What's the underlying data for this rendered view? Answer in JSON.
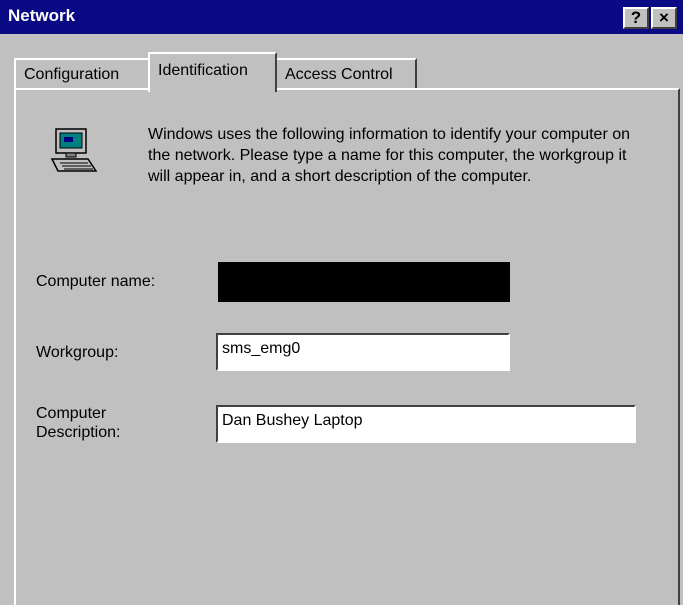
{
  "window": {
    "title": "Network",
    "help_label": "?",
    "close_label": "×"
  },
  "tabs": [
    {
      "label": "Configuration",
      "selected": false
    },
    {
      "label": "Identification",
      "selected": true
    },
    {
      "label": "Access Control",
      "selected": false
    }
  ],
  "identification": {
    "icon": "computer-icon",
    "description": "Windows uses the following information to identify your computer on the network.  Please type a name for this computer, the workgroup it will appear in, and a short description of the computer.",
    "computer_name_label": "Computer name:",
    "computer_name_value": "",
    "workgroup_label": "Workgroup:",
    "workgroup_value": "sms_emg0",
    "description_label": "Computer Description:",
    "description_value": "Dan Bushey Laptop"
  },
  "colors": {
    "titlebar": "#0a0a84",
    "face": "#c0c0c0",
    "redacted": "#000000"
  }
}
